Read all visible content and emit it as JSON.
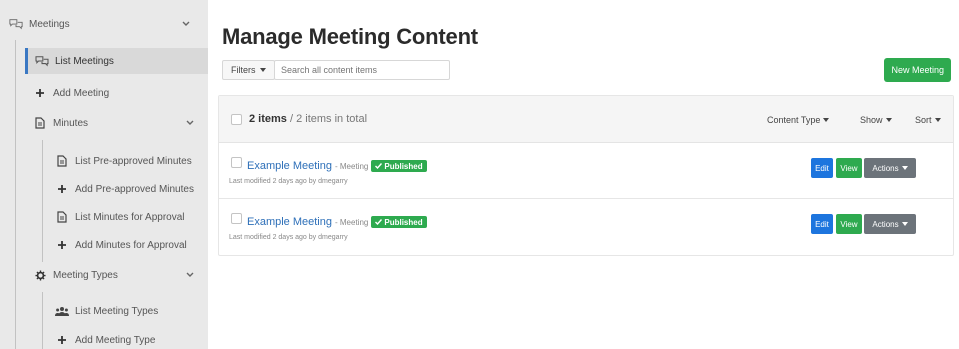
{
  "sidebar": {
    "meetings": "Meetings",
    "list_meetings": "List Meetings",
    "add_meeting": "Add Meeting",
    "minutes": "Minutes",
    "list_preapproved": "List Pre-approved Minutes",
    "add_preapproved": "Add Pre-approved Minutes",
    "list_for_approval": "List Minutes for Approval",
    "add_for_approval": "Add Minutes for Approval",
    "meeting_types": "Meeting Types",
    "list_meeting_types": "List Meeting Types",
    "add_meeting_type": "Add Meeting Type"
  },
  "main": {
    "title": "Manage Meeting Content",
    "filters_label": "Filters",
    "search_placeholder": "Search all content items",
    "new_button": "New Meeting",
    "items_count": "2 items",
    "items_total": " / 2 items in total",
    "content_type_label": "Content Type",
    "show_label": "Show",
    "sort_label": "Sort"
  },
  "rows": [
    {
      "title": "Example Meeting",
      "type": "- Meeting",
      "status": "Published",
      "meta": "Last modified 2 days ago by dmegarry",
      "edit": "Edit",
      "view": "View",
      "actions": "Actions"
    },
    {
      "title": "Example Meeting",
      "type": "- Meeting",
      "status": "Published",
      "meta": "Last modified 2 days ago by dmegarry",
      "edit": "Edit",
      "view": "View",
      "actions": "Actions"
    }
  ],
  "icons": {
    "meetings": "chat-bubbles-icon",
    "list_meetings": "chat-bubbles-icon",
    "add": "plus-icon",
    "minutes": "document-icon",
    "meeting_types": "gear-icon",
    "list_meeting_types": "users-icon",
    "expand": "chevron-down-icon"
  },
  "colors": {
    "accent_blue": "#1d75de",
    "success_green": "#2eaa4f",
    "actions_gray": "#6c737a",
    "link_blue": "#2d6fb8"
  }
}
